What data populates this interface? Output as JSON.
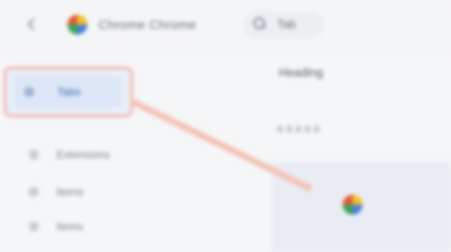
{
  "header": {
    "app_name": "Chrome Chrome",
    "tab_label": "Tab"
  },
  "sidebar": {
    "items": [
      {
        "label": "Tabs",
        "active": true
      },
      {
        "label": "Extensions"
      },
      {
        "label": "Items"
      },
      {
        "label": "Items"
      }
    ]
  },
  "main": {
    "title": "Heading",
    "subtitle": "a a a a a"
  },
  "colors": {
    "accent": "#3f63b5",
    "highlight_border": "#f2b8ad",
    "connector": "#f4c2b7"
  },
  "icons": [
    "chevron-left-icon",
    "chrome-logo-icon",
    "search-icon",
    "chrome-logo-icon"
  ]
}
